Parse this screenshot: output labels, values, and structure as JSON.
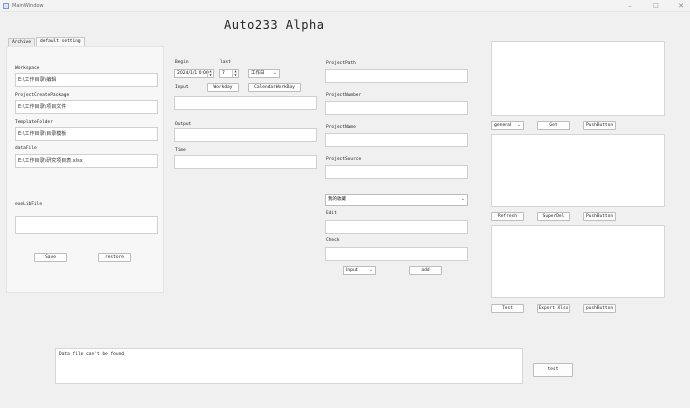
{
  "window": {
    "title": "MainWindow",
    "icons": {
      "app": "app-window-icon",
      "minimize": "minimize-icon",
      "maximize": "maximize-icon",
      "close": "close-icon"
    }
  },
  "heading": "Auto233 Alpha",
  "tabs": [
    {
      "label": "Archive"
    },
    {
      "label": "default setting"
    }
  ],
  "settings": {
    "workspace_label": "Workspace",
    "workspace_value": "E:\\工作目录\\编辑",
    "project_create_label": "ProjectCreatePackage",
    "project_create_value": "E:\\工作目录\\项目文件",
    "template_label": "TemplateFolder",
    "template_value": "E:\\工作目录\\目录模板",
    "datafile_label": "dataFile",
    "datafile_value": "E:\\工作目录\\研究项目表.xlsx",
    "exe_label": "exeLibFile",
    "exe_value": "",
    "save_label": "Save",
    "restore_label": "restore"
  },
  "middle": {
    "begin_label": "Begin",
    "last_label": "last",
    "begin_value": "2024/1/1 0:00",
    "last_value": "7",
    "unit_value": "工作日",
    "input_label": "Input",
    "workday_label": "Workday",
    "calendar_label": "CalendarWorkDay",
    "input_value": "",
    "output_label": "Output",
    "output_value": "",
    "time_label": "Time",
    "time_value": ""
  },
  "project": {
    "path_label": "ProjectPath",
    "number_label": "ProjectNumber",
    "name_label": "ProjectName",
    "source_label": "ProjectSource",
    "select_value": "我的收藏",
    "edit_label": "Edit",
    "check_label": "Check",
    "mode_value": "Input",
    "add_label": "add"
  },
  "right": {
    "general_value": "general",
    "get_label": "Get",
    "push_button_1": "PushButton",
    "refresh_label": "Refresh",
    "superdel_label": "SuperDel",
    "push_button_2": "PushButton",
    "test_label": "Test",
    "export_label": "Export Xlsx",
    "push_button_3": "pushButton"
  },
  "log": {
    "message": "Data file can't be found",
    "test_label": "test"
  }
}
